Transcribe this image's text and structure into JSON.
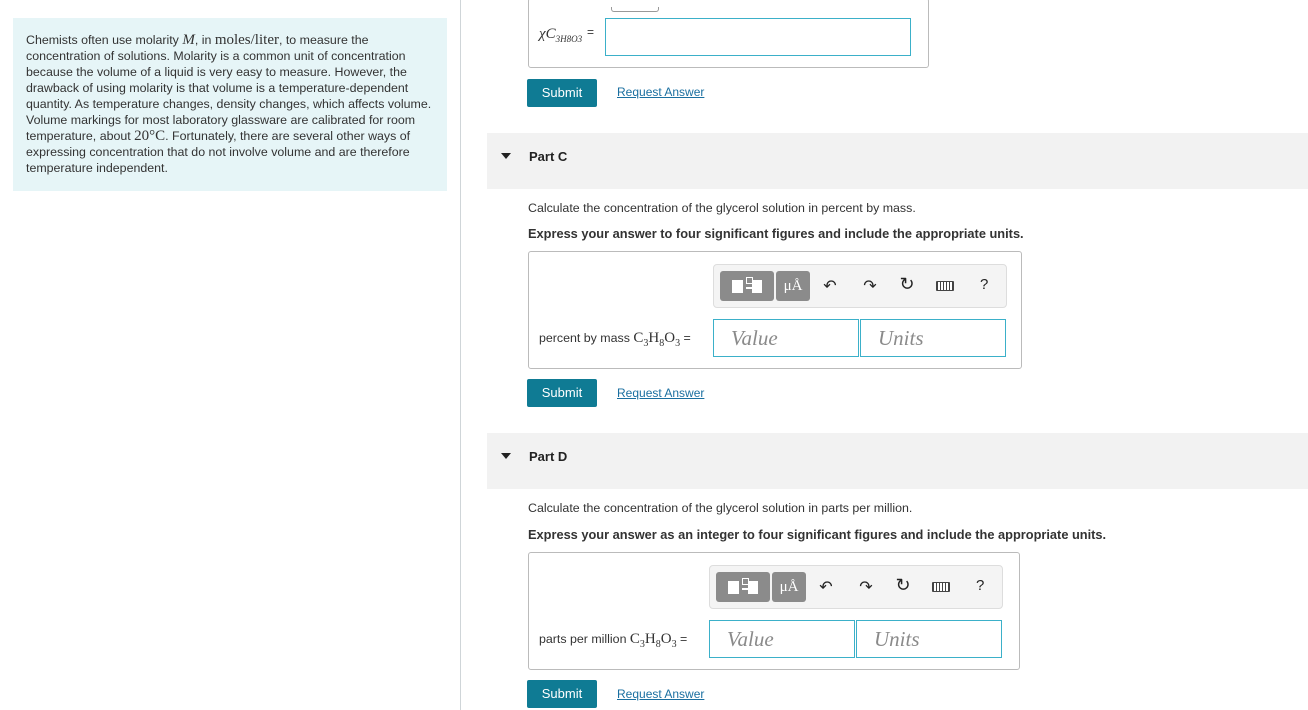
{
  "intro": {
    "t1": "Chemists often use molarity ",
    "m": "M",
    "t2": ", in ",
    "unit": "moles/liter",
    "t3": ", to measure the concentration of solutions. Molarity is a common unit of concentration because the volume of a liquid is very easy to measure. However, the drawback of using molarity is that volume is a temperature-dependent quantity. As temperature changes, density changes, which affects volume. Volume markings for most laboratory glassware are calibrated for room temperature, about ",
    "temp": "20°C",
    "t4": ". Fortunately, there are several other ways of expressing concentration that do not involve volume and are therefore temperature independent."
  },
  "partB": {
    "var_main": "χC",
    "var_sub": "3H8O3",
    "eq": "=",
    "submit": "Submit",
    "request": "Request Answer"
  },
  "partC": {
    "title": "Part C",
    "question": "Calculate the concentration of the glycerol solution in percent by mass.",
    "instruction": "Express your answer to four significant figures and include the appropriate units.",
    "label_text": "percent by mass ",
    "formula_c": "C",
    "formula_c_sub": "3",
    "formula_h": "H",
    "formula_h_sub": "8",
    "formula_o": "O",
    "formula_o_sub": "3",
    "eq": " =",
    "value_placeholder": "Value",
    "units_placeholder": "Units",
    "submit": "Submit",
    "request": "Request Answer"
  },
  "partD": {
    "title": "Part D",
    "question": "Calculate the concentration of the glycerol solution in parts per million.",
    "instruction": "Express your answer as an integer to four significant figures and include the appropriate units.",
    "label_text": "parts per million ",
    "formula_c": "C",
    "formula_c_sub": "3",
    "formula_h": "H",
    "formula_h_sub": "8",
    "formula_o": "O",
    "formula_o_sub": "3",
    "eq": " =",
    "value_placeholder": "Value",
    "units_placeholder": "Units",
    "submit": "Submit",
    "request": "Request Answer"
  },
  "toolbar": {
    "mu_label": "μÅ",
    "undo": "↶",
    "redo": "↷",
    "reset": "↻",
    "help": "?",
    "icons": [
      "templates-icon",
      "units-icon",
      "undo-icon",
      "redo-icon",
      "reset-icon",
      "keyboard-icon",
      "help-icon"
    ]
  },
  "colors": {
    "accent": "#0f7b94",
    "link": "#1a6fa0",
    "field_border": "#3bb0c9",
    "intro_bg": "#e6f5f7"
  }
}
